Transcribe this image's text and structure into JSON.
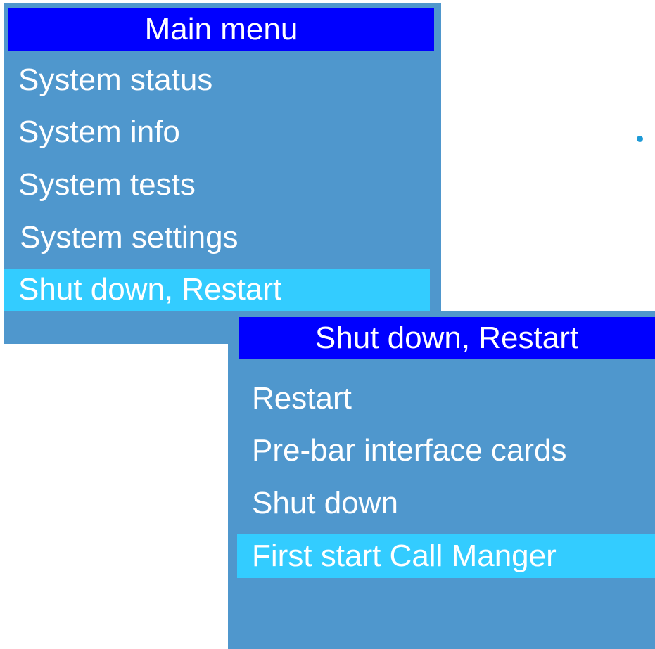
{
  "main_menu": {
    "title": "Main menu",
    "items": [
      {
        "label": "System status"
      },
      {
        "label": "System info"
      },
      {
        "label": "System tests"
      },
      {
        "label": "System settings"
      },
      {
        "label": "Shut down, Restart",
        "selected": true
      }
    ]
  },
  "submenu": {
    "title": "Shut down, Restart",
    "items": [
      {
        "label": "Restart"
      },
      {
        "label": "Pre-bar interface cards"
      },
      {
        "label": "Shut down"
      },
      {
        "label": "First start Call Manger",
        "selected": true
      }
    ]
  },
  "colors": {
    "panel_bg": "#4f97cd",
    "title_bg": "#0000ff",
    "selected_bg": "#33ccff",
    "text": "#ffffff"
  }
}
